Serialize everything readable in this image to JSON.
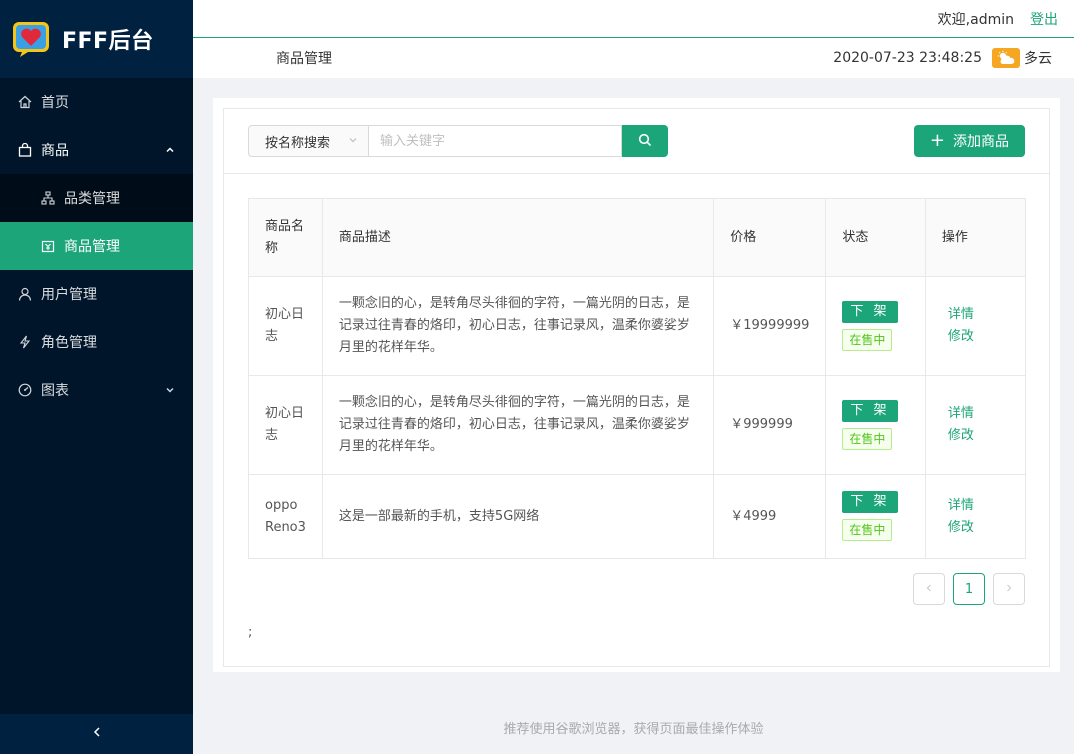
{
  "app": {
    "title": "FFF后台"
  },
  "sidebar": {
    "items": [
      {
        "label": "首页",
        "icon": "home-icon"
      },
      {
        "label": "商品",
        "icon": "bag-icon",
        "expanded": true,
        "children": [
          {
            "label": "品类管理",
            "icon": "sitemap-icon"
          },
          {
            "label": "商品管理",
            "icon": "product-icon",
            "active": true
          }
        ]
      },
      {
        "label": "用户管理",
        "icon": "user-icon"
      },
      {
        "label": "角色管理",
        "icon": "lightning-icon"
      },
      {
        "label": "图表",
        "icon": "dashboard-icon"
      }
    ],
    "collapse_icon": "chevron-left-icon"
  },
  "header": {
    "welcome": "欢迎,admin",
    "logout": "登出",
    "page_title": "商品管理",
    "datetime": "2020-07-23 23:48:25",
    "weather": "多云"
  },
  "toolbar": {
    "search_type": "按名称搜索",
    "search_placeholder": "输入关键字",
    "add_label": "添加商品"
  },
  "table": {
    "headers": [
      "商品名称",
      "商品描述",
      "价格",
      "状态",
      "操作"
    ],
    "rows": [
      {
        "name": "初心日志",
        "desc": "一颗念旧的心，是转角尽头徘徊的字符，一篇光阴的日志，是记录过往青春的烙印，初心日志，往事记录风，温柔你婆娑岁月里的花样年华。",
        "price": "￥19999999",
        "action": "下 架",
        "status": "在售中",
        "ops": [
          "详情",
          "修改"
        ]
      },
      {
        "name": "初心日志",
        "desc": "一颗念旧的心，是转角尽头徘徊的字符，一篇光阴的日志，是记录过往青春的烙印，初心日志，往事记录风，温柔你婆娑岁月里的花样年华。",
        "price": "￥999999",
        "action": "下 架",
        "status": "在售中",
        "ops": [
          "详情",
          "修改"
        ]
      },
      {
        "name": "oppo Reno3",
        "desc": "这是一部最新的手机，支持5G网络",
        "price": "￥4999",
        "action": "下 架",
        "status": "在售中",
        "ops": [
          "详情",
          "修改"
        ]
      }
    ]
  },
  "pagination": {
    "current": "1"
  },
  "stray_text": ";",
  "footer": "推荐使用谷歌浏览器，获得页面最佳操作体验",
  "colors": {
    "primary": "#1da57a",
    "sidebar_bg": "#001529",
    "weather": "#f5a623"
  }
}
